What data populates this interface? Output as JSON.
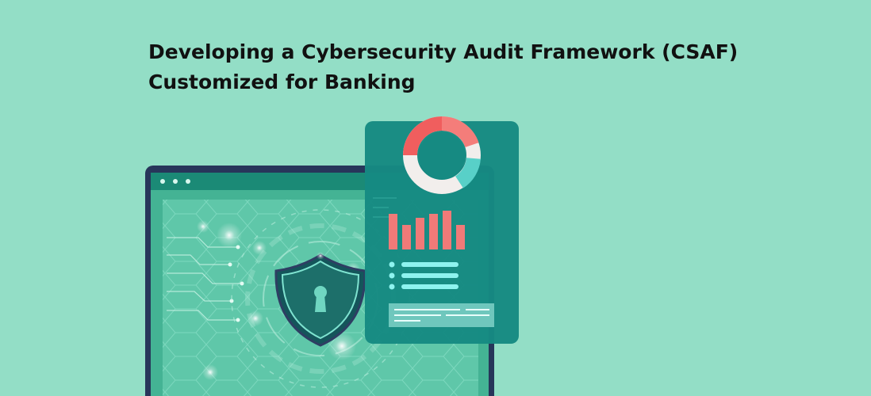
{
  "heading": {
    "line1": "Developing a Cybersecurity Audit Framework (CSAF)",
    "line2": "Customized for Banking"
  },
  "colors": {
    "background": "#93dec6",
    "laptop_frame": "#27365a",
    "screen": "#5fc7a9",
    "panel": "#168a82",
    "bar": "#f07a78",
    "donut_red": "#f05e5e",
    "donut_white": "#f2eeec",
    "donut_teal": "#58d0c8",
    "list_line": "#8ef3ef"
  },
  "icons": {
    "shield": "shield-keyhole-icon",
    "window_dots": "window-dots-icon",
    "donut": "donut-chart-icon",
    "bars": "bar-chart-icon"
  }
}
